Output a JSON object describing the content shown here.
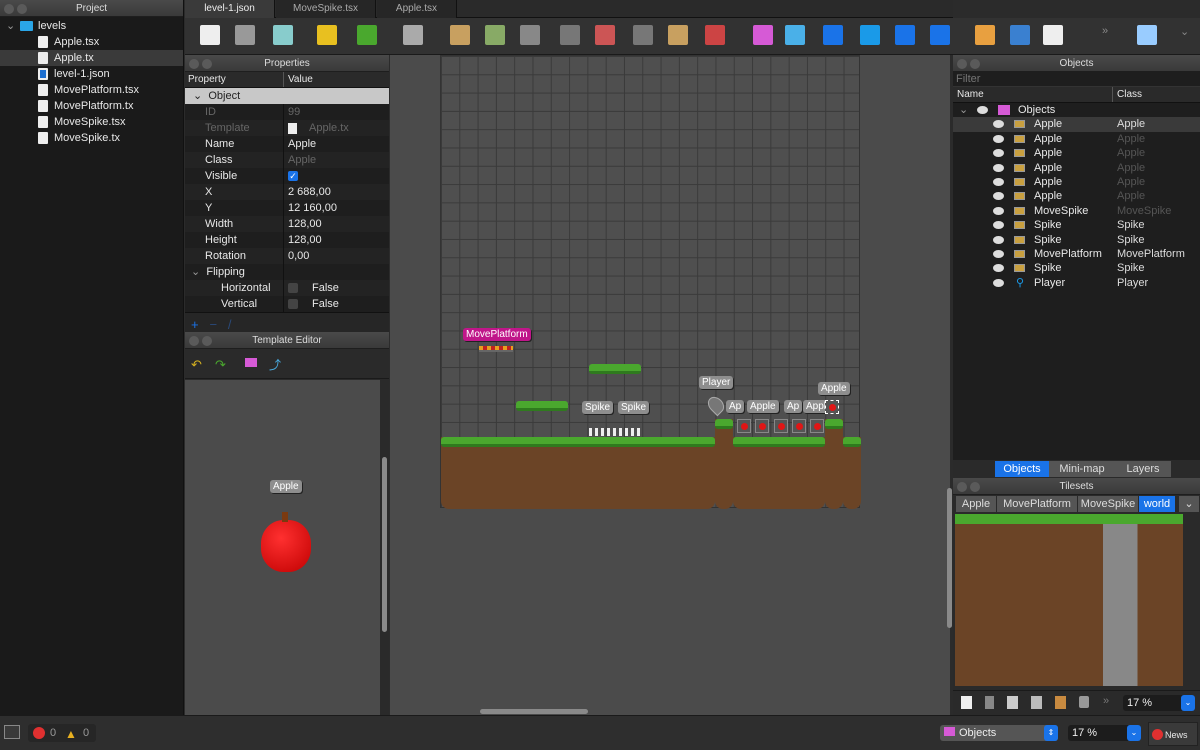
{
  "project": {
    "title": "Project",
    "folder": "levels",
    "files": [
      {
        "name": "Apple.tsx",
        "type": "tileset"
      },
      {
        "name": "Apple.tx",
        "type": "template",
        "selected": true
      },
      {
        "name": "level-1.json",
        "type": "map"
      },
      {
        "name": "MovePlatform.tsx",
        "type": "tileset"
      },
      {
        "name": "MovePlatform.tx",
        "type": "template"
      },
      {
        "name": "MoveSpike.tsx",
        "type": "tileset"
      },
      {
        "name": "MoveSpike.tx",
        "type": "template"
      }
    ]
  },
  "tabs": [
    {
      "label": "level-1.json",
      "active": true
    },
    {
      "label": "MoveSpike.tsx"
    },
    {
      "label": "Apple.tsx"
    }
  ],
  "toolbar": {
    "icons": [
      "new-map-icon",
      "open-icon",
      "save-icon",
      "undo-icon",
      "redo-icon",
      "world-icon",
      "stamp-brush-icon",
      "terrain-brush-icon",
      "bucket-fill-icon",
      "shape-fill-icon",
      "eraser-icon",
      "rect-select-icon",
      "magic-wand-icon",
      "select-same-tile-icon",
      "insert-tile-icon",
      "edit-polygons-icon",
      "insert-rectangle-icon",
      "insert-point-icon",
      "insert-ellipse-icon",
      "insert-polygon-icon",
      "insert-image-icon",
      "select-objects-icon",
      "insert-text-icon",
      "more-icon",
      "flip-icon",
      "chevron-down-icon"
    ]
  },
  "properties": {
    "title": "Properties",
    "col_property": "Property",
    "col_value": "Value",
    "group": "Object",
    "rows": [
      {
        "k": "ID",
        "v": "99",
        "dim": true
      },
      {
        "k": "Template",
        "v": "Apple.tx",
        "dim": true
      },
      {
        "k": "Name",
        "v": "Apple"
      },
      {
        "k": "Class",
        "v": "Apple",
        "vdim": true
      },
      {
        "k": "Visible",
        "v": "",
        "checked": true
      },
      {
        "k": "X",
        "v": "2 688,00"
      },
      {
        "k": "Y",
        "v": "12 160,00"
      },
      {
        "k": "Width",
        "v": "128,00"
      },
      {
        "k": "Height",
        "v": "128,00"
      },
      {
        "k": "Rotation",
        "v": "0,00"
      }
    ],
    "flipping": "Flipping",
    "flip_rows": [
      {
        "k": "Horizontal",
        "v": "False"
      },
      {
        "k": "Vertical",
        "v": "False"
      }
    ]
  },
  "template_editor": {
    "title": "Template Editor",
    "object_label": "Apple"
  },
  "map": {
    "labels": {
      "move_platform": "MovePlatform",
      "spike1": "Spike",
      "spike2": "Spike",
      "player": "Player",
      "apple_a": "Ap",
      "apple_b": "Apple",
      "apple_c": "Ap",
      "apple_d": "Apple",
      "apple_top": "Apple"
    }
  },
  "objects": {
    "title": "Objects",
    "filter_placeholder": "Filter",
    "col_name": "Name",
    "col_class": "Class",
    "layer": "Objects",
    "items": [
      {
        "name": "Apple",
        "class": "Apple",
        "sel": true
      },
      {
        "name": "Apple",
        "class": "Apple",
        "inherited": true
      },
      {
        "name": "Apple",
        "class": "Apple",
        "inherited": true
      },
      {
        "name": "Apple",
        "class": "Apple",
        "inherited": true
      },
      {
        "name": "Apple",
        "class": "Apple",
        "inherited": true
      },
      {
        "name": "Apple",
        "class": "Apple",
        "inherited": true
      },
      {
        "name": "MoveSpike",
        "class": "MoveSpike",
        "inherited": true
      },
      {
        "name": "Spike",
        "class": "Spike"
      },
      {
        "name": "Spike",
        "class": "Spike"
      },
      {
        "name": "MovePlatform",
        "class": "MovePlatform"
      },
      {
        "name": "Spike",
        "class": "Spike"
      },
      {
        "name": "Player",
        "class": "Player",
        "point": true
      }
    ]
  },
  "object_tabs": [
    {
      "label": "Objects",
      "active": true
    },
    {
      "label": "Mini-map"
    },
    {
      "label": "Layers"
    }
  ],
  "tilesets": {
    "title": "Tilesets",
    "tabs": [
      {
        "label": "Apple"
      },
      {
        "label": "MovePlatform"
      },
      {
        "label": "MoveSpike"
      },
      {
        "label": "world",
        "active": true
      }
    ],
    "zoom": "17 %"
  },
  "status": {
    "errors": "0",
    "warnings": "0",
    "layer": "Objects",
    "zoom": "17 %",
    "news": "News"
  },
  "colors": {
    "accent": "#1a73e8",
    "move_platform_label": "#c0168a",
    "grass": "#4aa82e",
    "dirt": "#6b4426"
  }
}
